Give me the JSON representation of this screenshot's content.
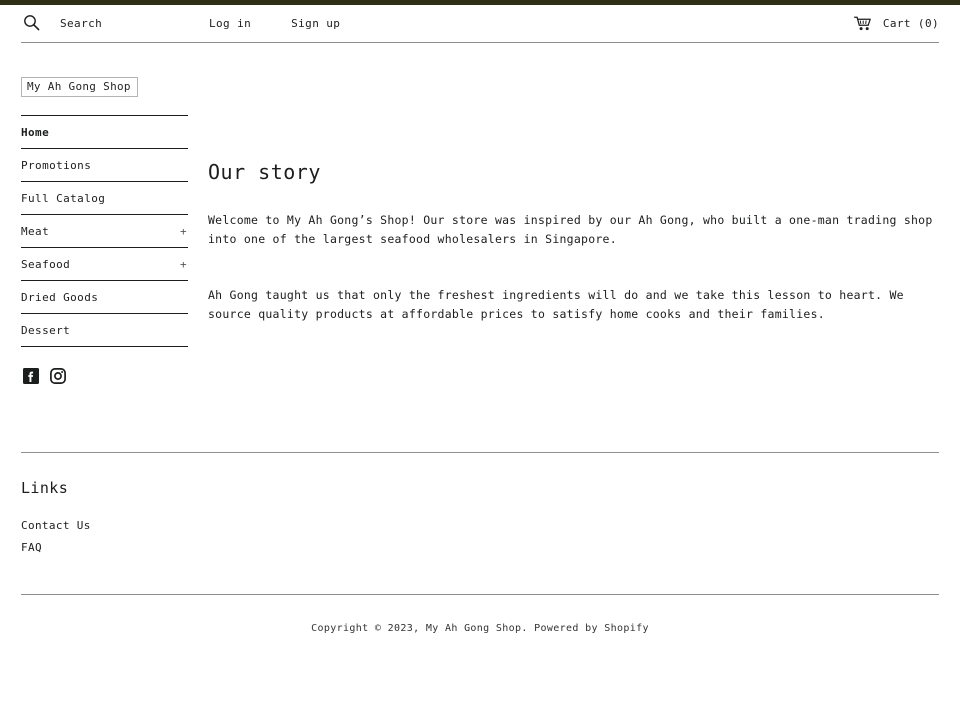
{
  "theme": {
    "accent_band_color": "#2f2f15",
    "text_color": "#1c1d1d",
    "rule_color": "#8f8f8f"
  },
  "header": {
    "search_icon": "search-icon",
    "search_label": "Search",
    "login_label": "Log in",
    "signup_label": "Sign up",
    "cart_icon": "shopping-cart-icon",
    "cart_label": "Cart (0)"
  },
  "logo": {
    "alt_text": "My Ah Gong Shop"
  },
  "sidebar": {
    "items": [
      {
        "label": "Home",
        "active": true,
        "expander": ""
      },
      {
        "label": "Promotions",
        "active": false,
        "expander": ""
      },
      {
        "label": "Full Catalog",
        "active": false,
        "expander": ""
      },
      {
        "label": "Meat",
        "active": false,
        "expander": "+"
      },
      {
        "label": "Seafood",
        "active": false,
        "expander": "+"
      },
      {
        "label": "Dried Goods",
        "active": false,
        "expander": ""
      },
      {
        "label": "Dessert",
        "active": false,
        "expander": ""
      }
    ],
    "social": [
      {
        "name": "facebook-icon"
      },
      {
        "name": "instagram-icon"
      }
    ]
  },
  "main": {
    "title": "Our story",
    "paragraphs": [
      "Welcome to My Ah Gong’s Shop! Our store was inspired by our Ah Gong, who built a one-man trading shop into one of the largest seafood wholesalers in Singapore.",
      "Ah Gong taught us that only the freshest ingredients will do and we take this lesson to heart. We source quality products at affordable prices to satisfy home cooks and their families."
    ]
  },
  "footer": {
    "links_title": "Links",
    "links": [
      {
        "label": "Contact Us"
      },
      {
        "label": "FAQ"
      }
    ],
    "copyright_prefix": "Copyright © 2023, ",
    "shop_name": "My Ah Gong Shop",
    "copyright_middle": ". Powered by ",
    "platform": "Shopify"
  }
}
